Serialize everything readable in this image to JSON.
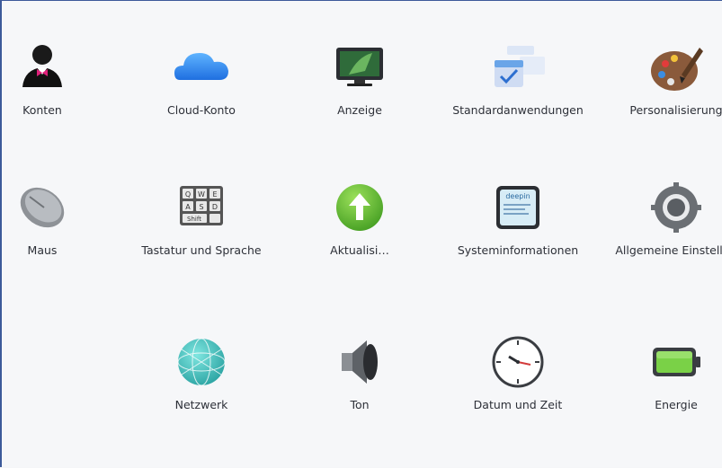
{
  "items": [
    {
      "label": "Konten",
      "icon": "user-accounts-icon"
    },
    {
      "label": "Cloud-Konto",
      "icon": "cloud-icon"
    },
    {
      "label": "Anzeige",
      "icon": "display-monitor-icon"
    },
    {
      "label": "Standardanwendungen",
      "icon": "default-apps-icon"
    },
    {
      "label": "Personalisierung",
      "icon": "palette-icon"
    },
    {
      "label": "Maus",
      "icon": "mouse-icon"
    },
    {
      "label": "Tastatur und Sprache",
      "icon": "keyboard-icon"
    },
    {
      "label": "Aktualisi…",
      "icon": "update-arrow-icon"
    },
    {
      "label": "Systeminformationen",
      "icon": "system-info-icon"
    },
    {
      "label": "Allgemeine Einstellun",
      "icon": "gear-icon"
    },
    {
      "label": "Netzwerk",
      "icon": "network-globe-icon"
    },
    {
      "label": "Ton",
      "icon": "speaker-icon"
    },
    {
      "label": "Datum und Zeit",
      "icon": "clock-icon"
    },
    {
      "label": "Energie",
      "icon": "battery-icon"
    }
  ],
  "keyboard_keys": [
    "Q",
    "W",
    "E",
    "A",
    "S",
    "D",
    "Shift"
  ],
  "sysinfo_brand": "deepin"
}
